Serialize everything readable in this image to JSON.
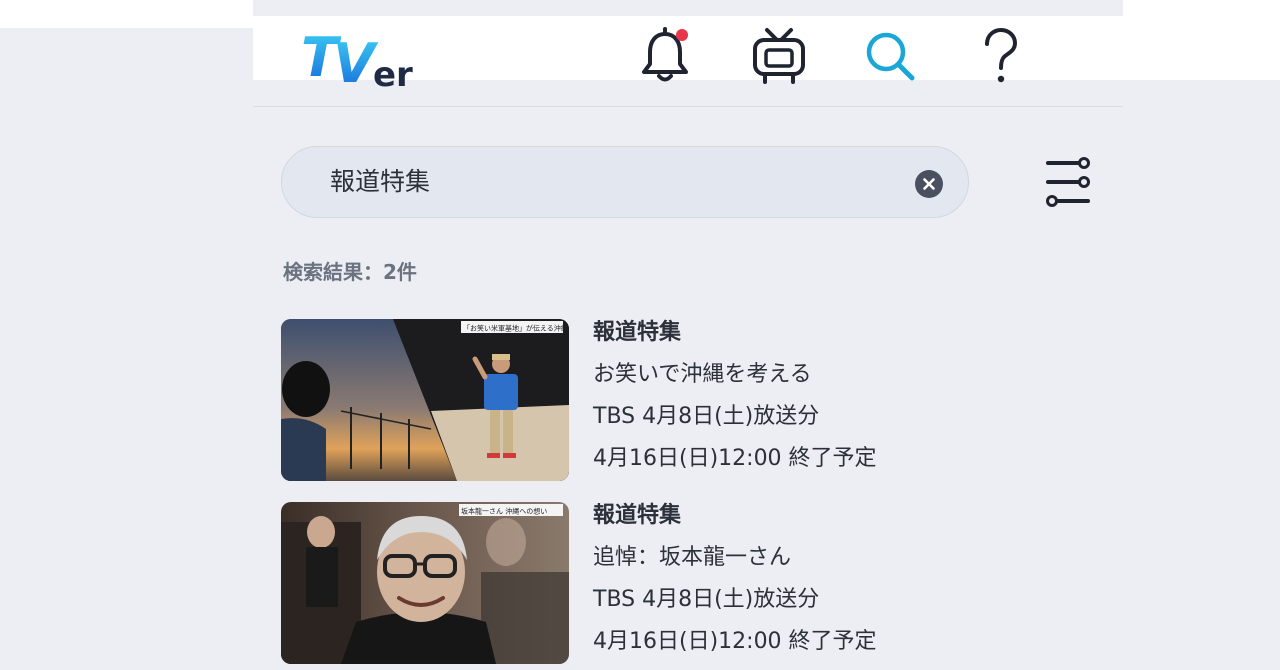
{
  "header": {
    "logo_text": "TVer",
    "icons": [
      "bell-icon",
      "tv-icon",
      "search-icon",
      "help-icon"
    ],
    "notification_dot_color": "#e8354a",
    "accent_color": "#1aa7d8"
  },
  "search": {
    "query": "報道特集"
  },
  "results": {
    "count_label": "検索結果：2件",
    "items": [
      {
        "title": "報道特集",
        "subtitle": "お笑いで沖縄を考える",
        "broadcast": "TBS 4月8日(土)放送分",
        "expiry": "4月16日(日)12:00 終了予定",
        "thumb_caption": "「お笑い米軍基地」が伝える沖縄"
      },
      {
        "title": "報道特集",
        "subtitle": "追悼：坂本龍一さん",
        "broadcast": "TBS 4月8日(土)放送分",
        "expiry": "4月16日(日)12:00 終了予定",
        "thumb_caption": "坂本龍一さん 沖縄への想い"
      }
    ]
  }
}
